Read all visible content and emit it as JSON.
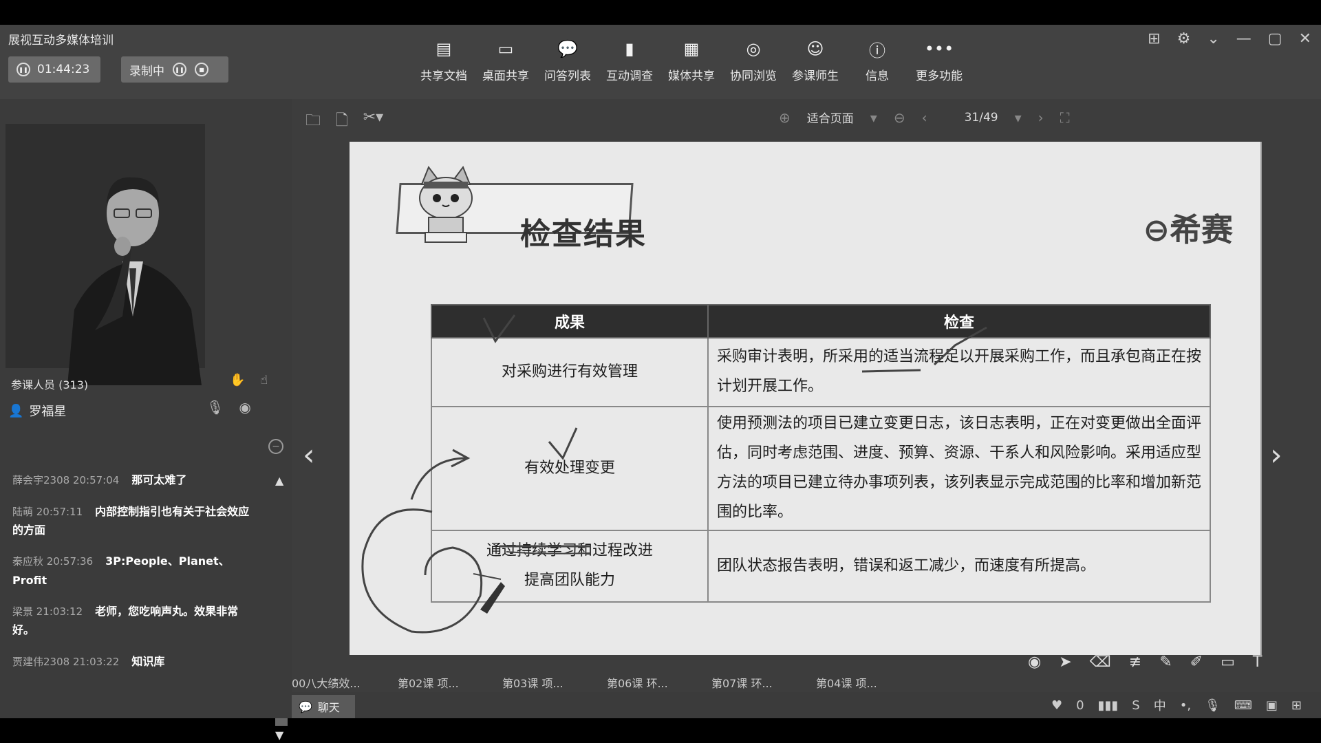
{
  "app": {
    "title": "展视互动多媒体培训",
    "timer": "01:44:23",
    "recording": "录制中"
  },
  "toolbar": [
    {
      "label": "共享文档",
      "icon": "document-icon"
    },
    {
      "label": "桌面共享",
      "icon": "desktop-icon"
    },
    {
      "label": "问答列表",
      "icon": "qa-icon"
    },
    {
      "label": "互动调查",
      "icon": "chart-icon"
    },
    {
      "label": "媒体共享",
      "icon": "film-icon"
    },
    {
      "label": "协同浏览",
      "icon": "compass-icon"
    },
    {
      "label": "参课师生",
      "icon": "people-icon"
    },
    {
      "label": "信息",
      "icon": "info-icon"
    },
    {
      "label": "更多功能",
      "icon": "more-icon"
    }
  ],
  "participants": {
    "header": "参课人员 (313)",
    "name": "罗福星"
  },
  "chat": [
    {
      "who": "薛会宇2308 20:57:04",
      "text": "那可太难了"
    },
    {
      "who": "陆萌 20:57:11",
      "text": "内部控制指引也有关于社会效应的方面"
    },
    {
      "who": "秦应秋 20:57:36",
      "text": "3P:People、Planet、Profit"
    },
    {
      "who": "梁景 21:03:12",
      "text": "老师，您吃响声丸。效果非常好。"
    },
    {
      "who": "贾建伟2308 21:03:22",
      "text": "知识库"
    }
  ],
  "docbar": {
    "zoom": "适合页面",
    "page": "31/49"
  },
  "slide": {
    "title": "检查结果",
    "brand": "希赛",
    "headers": [
      "成果",
      "检查"
    ],
    "rows": [
      {
        "result": "对采购进行有效管理",
        "check": "采购审计表明，所采用的适当流程足以开展采购工作，而且承包商正在按计划开展工作。"
      },
      {
        "result": "有效处理变更",
        "check": "使用预测法的项目已建立变更日志，该日志表明，正在对变更做出全面评估，同时考虑范围、进度、预算、资源、干系人和风险影响。采用适应型方法的项目已建立待办事项列表，该列表显示完成范围的比率和增加新范围的比率。"
      },
      {
        "result": "通过持续学习和过程改进提高团队能力",
        "check": "团队状态报告表明，错误和返工减少，而速度有所提高。"
      }
    ]
  },
  "tabs": [
    "00八大绩效...",
    "第02课 项...",
    "第03课 项...",
    "第06课 环...",
    "第07课 环...",
    "第04课 项..."
  ],
  "bottom": {
    "chat_button": "聊天",
    "likes": "0"
  }
}
